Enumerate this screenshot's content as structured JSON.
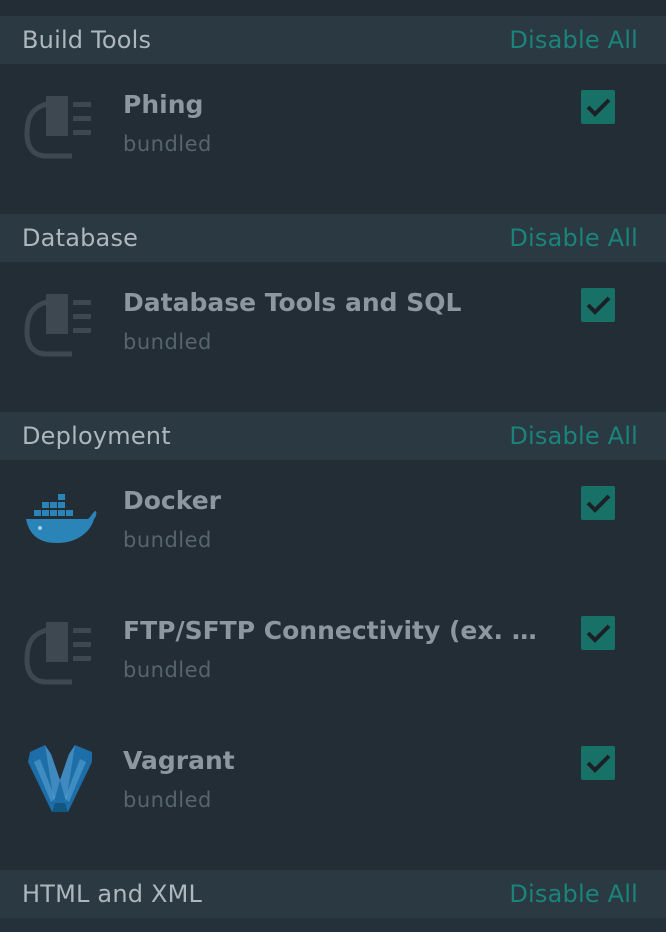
{
  "categories": [
    {
      "title": "Build Tools",
      "action_label": "Disable All",
      "plugins": [
        {
          "name": "Phing",
          "source": "bundled",
          "icon": "plug-icon",
          "enabled": true
        }
      ]
    },
    {
      "title": "Database",
      "action_label": "Disable All",
      "plugins": [
        {
          "name": "Database Tools and SQL",
          "source": "bundled",
          "icon": "plug-icon",
          "enabled": true
        }
      ]
    },
    {
      "title": "Deployment",
      "action_label": "Disable All",
      "plugins": [
        {
          "name": "Docker",
          "source": "bundled",
          "icon": "docker-whale-icon",
          "enabled": true
        },
        {
          "name": "FTP/SFTP Connectivity (ex. Re...",
          "source": "bundled",
          "icon": "plug-icon",
          "enabled": true
        },
        {
          "name": "Vagrant",
          "source": "bundled",
          "icon": "vagrant-logo-icon",
          "enabled": true
        }
      ]
    },
    {
      "title": "HTML and XML",
      "action_label": "Disable All",
      "plugins": []
    }
  ],
  "colors": {
    "background": "#232d36",
    "header_background": "#2b3943",
    "accent": "#1a847b",
    "checkbox": "#177167"
  }
}
